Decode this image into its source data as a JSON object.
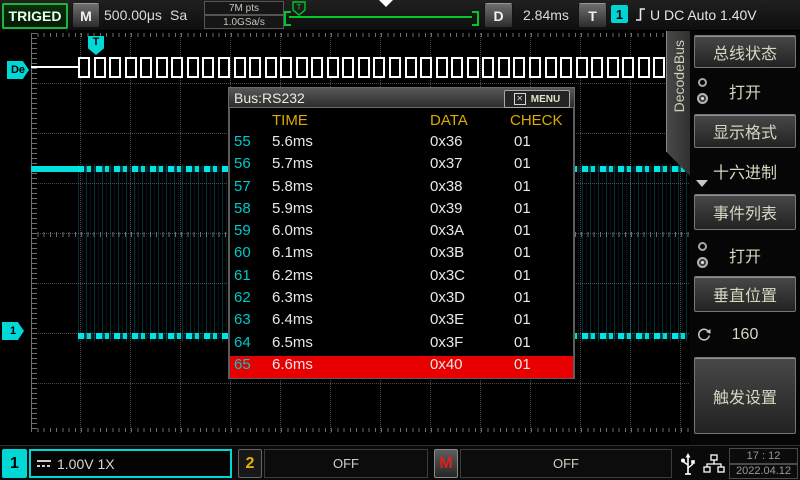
{
  "top_bar": {
    "trigger_status": "TRIGED",
    "m_button": "M",
    "timebase": "500.00μs",
    "sa_label": "Sa",
    "memory_depth": "7M pts",
    "sample_rate": "1.0GSa/s",
    "d_button": "D",
    "horizontal_delay": "2.84ms",
    "t_button": "T",
    "trigger_source_badge": "1",
    "trigger_info": "U DC Auto 1.40V"
  },
  "waveform": {
    "decode_marker_label": "De",
    "trigger_flag_label": "T",
    "ch1_marker_label": "1",
    "decode_frame_count": 38,
    "colors": {
      "ch1": "#00dcdc",
      "decode_frame": "#ffffff",
      "grid": "#4a4a4a"
    }
  },
  "decode_tab_label": "DecodeBus",
  "event_table": {
    "title": "Bus:RS232",
    "menu_button": "MENU",
    "columns": [
      "TIME",
      "DATA",
      "CHECK"
    ],
    "selected_index": "65",
    "rows": [
      {
        "idx": "55",
        "time": "5.6ms",
        "data": "0x36",
        "check": "01"
      },
      {
        "idx": "56",
        "time": "5.7ms",
        "data": "0x37",
        "check": "01"
      },
      {
        "idx": "57",
        "time": "5.8ms",
        "data": "0x38",
        "check": "01"
      },
      {
        "idx": "58",
        "time": "5.9ms",
        "data": "0x39",
        "check": "01"
      },
      {
        "idx": "59",
        "time": "6.0ms",
        "data": "0x3A",
        "check": "01"
      },
      {
        "idx": "60",
        "time": "6.1ms",
        "data": "0x3B",
        "check": "01"
      },
      {
        "idx": "61",
        "time": "6.2ms",
        "data": "0x3C",
        "check": "01"
      },
      {
        "idx": "62",
        "time": "6.3ms",
        "data": "0x3D",
        "check": "01"
      },
      {
        "idx": "63",
        "time": "6.4ms",
        "data": "0x3E",
        "check": "01"
      },
      {
        "idx": "64",
        "time": "6.5ms",
        "data": "0x3F",
        "check": "01"
      },
      {
        "idx": "65",
        "time": "6.6ms",
        "data": "0x40",
        "check": "01"
      }
    ]
  },
  "sidebar": {
    "items": [
      {
        "label": "总线状态",
        "style": "button",
        "icon": ""
      },
      {
        "label": "打开",
        "style": "value",
        "icon": "radio"
      },
      {
        "label": "显示格式",
        "style": "button",
        "icon": ""
      },
      {
        "label": "十六进制",
        "style": "value",
        "icon": "dropdown"
      },
      {
        "label": "事件列表",
        "style": "button",
        "icon": ""
      },
      {
        "label": "打开",
        "style": "value",
        "icon": "radio"
      },
      {
        "label": "垂直位置",
        "style": "button",
        "icon": ""
      },
      {
        "label": "160",
        "style": "value",
        "icon": "knob"
      },
      {
        "label": "触发设置",
        "style": "button-large",
        "icon": ""
      }
    ]
  },
  "bottom_bar": {
    "ch1_badge": "1",
    "ch1_settings": "1.00V 1X",
    "ch2_badge": "2",
    "ch2_status": "OFF",
    "math_badge": "M",
    "math_status": "OFF",
    "time": "17 : 12",
    "date": "2022.04.12"
  },
  "colors": {
    "accent_cyan": "#00dcdc",
    "header_yellow": "#dcaa00",
    "selected_red": "#e80000",
    "status_green": "#00c828",
    "panel_text": "#d6d6c0"
  }
}
